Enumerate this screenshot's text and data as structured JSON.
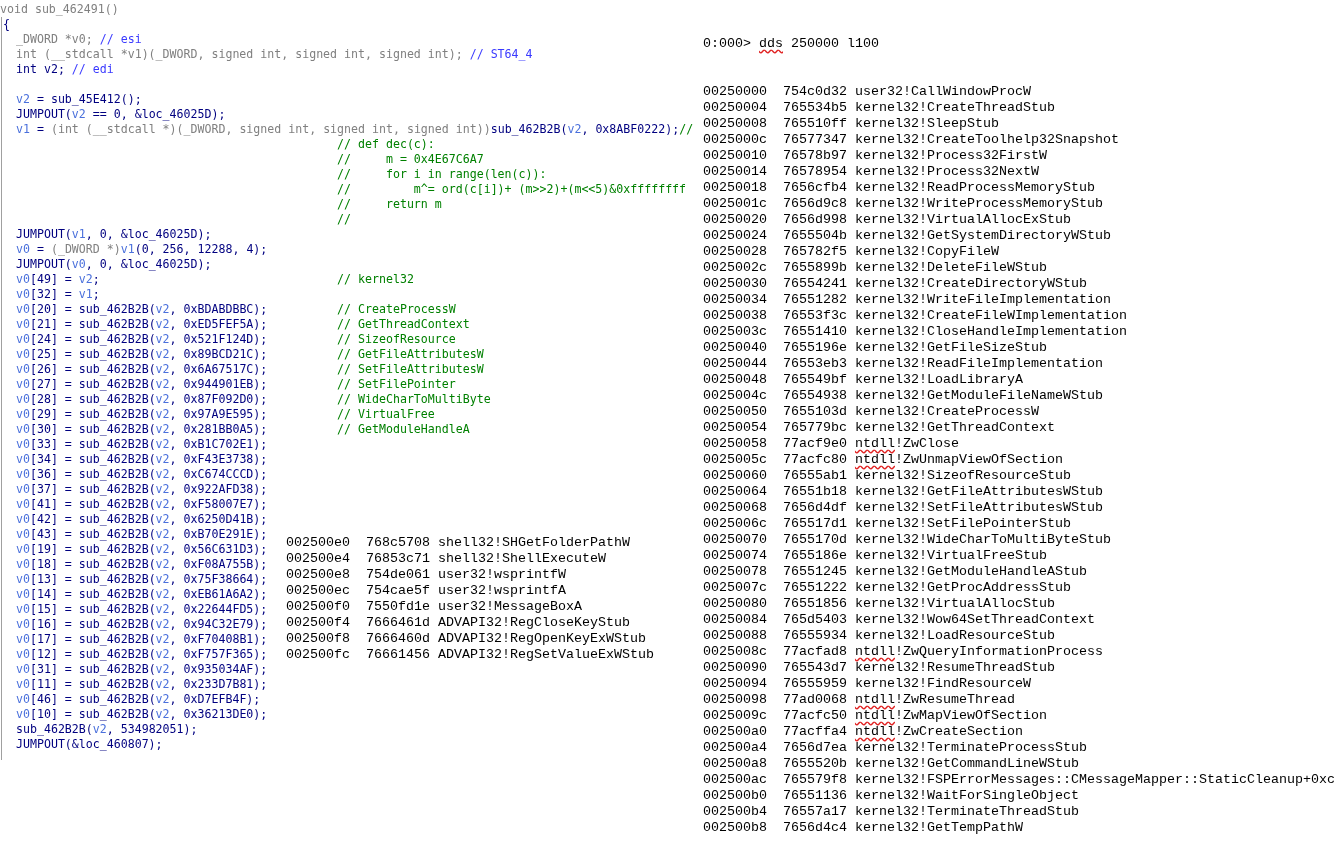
{
  "pseudocode": {
    "signature": [
      {
        "text": "void sub_462491()",
        "kind": "muted"
      }
    ],
    "brace": "{",
    "lines": [
      {
        "kind": "code",
        "segments": [
          {
            "text": "_DWORD *v0; ",
            "kind": "muted"
          },
          {
            "text": "// esi",
            "kind": "register"
          }
        ]
      },
      {
        "kind": "code",
        "segments": [
          {
            "text": "int (__stdcall *v1)(_DWORD, signed int, signed int, signed int); ",
            "kind": "muted"
          },
          {
            "text": "// ST64_4",
            "kind": "register"
          }
        ]
      },
      {
        "kind": "code",
        "segments": [
          {
            "text": "int v2; ",
            "kind": "plain"
          },
          {
            "text": "// edi",
            "kind": "register"
          }
        ]
      },
      {
        "kind": "blank"
      },
      {
        "kind": "code",
        "segments": [
          {
            "text": "v2",
            "kind": "variable"
          },
          {
            "text": " = sub_45E412();",
            "kind": "plain"
          }
        ]
      },
      {
        "kind": "code",
        "segments": [
          {
            "text": "JUMPOUT(",
            "kind": "plain"
          },
          {
            "text": "v2",
            "kind": "variable"
          },
          {
            "text": " == 0, &loc_46025D);",
            "kind": "plain"
          }
        ]
      },
      {
        "kind": "code",
        "segments": [
          {
            "text": "v1",
            "kind": "variable"
          },
          {
            "text": " = ",
            "kind": "plain"
          },
          {
            "text": "(int (__stdcall *)(_DWORD, signed int, signed int, signed int))",
            "kind": "muted"
          },
          {
            "text": "sub_462B2B(",
            "kind": "plain"
          },
          {
            "text": "v2",
            "kind": "variable"
          },
          {
            "text": ", 0x8ABF0222);",
            "kind": "plain"
          },
          {
            "text": "//",
            "kind": "comment"
          }
        ]
      },
      {
        "kind": "comment",
        "comment": "// def dec(c):"
      },
      {
        "kind": "comment",
        "comment": "//     m = 0x4E67C6A7"
      },
      {
        "kind": "comment",
        "comment": "//     for i in range(len(c)):"
      },
      {
        "kind": "comment",
        "comment": "//         m^= ord(c[i])+ (m>>2)+(m<<5)&0xffffffff"
      },
      {
        "kind": "comment",
        "comment": "//     return m"
      },
      {
        "kind": "comment",
        "comment": "//"
      },
      {
        "kind": "code",
        "segments": [
          {
            "text": "JUMPOUT(",
            "kind": "plain"
          },
          {
            "text": "v1",
            "kind": "variable"
          },
          {
            "text": ", 0, &loc_46025D);",
            "kind": "plain"
          }
        ]
      },
      {
        "kind": "code",
        "segments": [
          {
            "text": "v0",
            "kind": "variable"
          },
          {
            "text": " = ",
            "kind": "plain"
          },
          {
            "text": "(_DWORD *)",
            "kind": "muted"
          },
          {
            "text": "v1",
            "kind": "variable"
          },
          {
            "text": "(0, 256, 12288, 4);",
            "kind": "plain"
          }
        ]
      },
      {
        "kind": "code",
        "segments": [
          {
            "text": "JUMPOUT(",
            "kind": "plain"
          },
          {
            "text": "v0",
            "kind": "variable"
          },
          {
            "text": ", 0, &loc_46025D);",
            "kind": "plain"
          }
        ]
      },
      {
        "kind": "code",
        "segments": [
          {
            "text": "v0",
            "kind": "variable"
          },
          {
            "text": "[49] = ",
            "kind": "plain"
          },
          {
            "text": "v2",
            "kind": "variable"
          },
          {
            "text": ";",
            "kind": "plain"
          }
        ],
        "comment": "// kernel32"
      },
      {
        "kind": "code",
        "segments": [
          {
            "text": "v0",
            "kind": "variable"
          },
          {
            "text": "[32] = ",
            "kind": "plain"
          },
          {
            "text": "v1",
            "kind": "variable"
          },
          {
            "text": ";",
            "kind": "plain"
          }
        ]
      },
      {
        "kind": "code",
        "segments": [
          {
            "text": "v0",
            "kind": "variable"
          },
          {
            "text": "[20] = sub_462B2B(",
            "kind": "plain"
          },
          {
            "text": "v2",
            "kind": "variable"
          },
          {
            "text": ", 0xBDABDBBC);",
            "kind": "plain"
          }
        ],
        "comment": "// CreateProcessW"
      },
      {
        "kind": "code",
        "segments": [
          {
            "text": "v0",
            "kind": "variable"
          },
          {
            "text": "[21] = sub_462B2B(",
            "kind": "plain"
          },
          {
            "text": "v2",
            "kind": "variable"
          },
          {
            "text": ", 0xED5FEF5A);",
            "kind": "plain"
          }
        ],
        "comment": "// GetThreadContext"
      },
      {
        "kind": "code",
        "segments": [
          {
            "text": "v0",
            "kind": "variable"
          },
          {
            "text": "[24] = sub_462B2B(",
            "kind": "plain"
          },
          {
            "text": "v2",
            "kind": "variable"
          },
          {
            "text": ", 0x521F124D);",
            "kind": "plain"
          }
        ],
        "comment": "// SizeofResource"
      },
      {
        "kind": "code",
        "segments": [
          {
            "text": "v0",
            "kind": "variable"
          },
          {
            "text": "[25] = sub_462B2B(",
            "kind": "plain"
          },
          {
            "text": "v2",
            "kind": "variable"
          },
          {
            "text": ", 0x89BCD21C);",
            "kind": "plain"
          }
        ],
        "comment": "// GetFileAttributesW"
      },
      {
        "kind": "code",
        "segments": [
          {
            "text": "v0",
            "kind": "variable"
          },
          {
            "text": "[26] = sub_462B2B(",
            "kind": "plain"
          },
          {
            "text": "v2",
            "kind": "variable"
          },
          {
            "text": ", 0x6A67517C);",
            "kind": "plain"
          }
        ],
        "comment": "// SetFileAttributesW"
      },
      {
        "kind": "code",
        "segments": [
          {
            "text": "v0",
            "kind": "variable"
          },
          {
            "text": "[27] = sub_462B2B(",
            "kind": "plain"
          },
          {
            "text": "v2",
            "kind": "variable"
          },
          {
            "text": ", 0x944901EB);",
            "kind": "plain"
          }
        ],
        "comment": "// SetFilePointer"
      },
      {
        "kind": "code",
        "segments": [
          {
            "text": "v0",
            "kind": "variable"
          },
          {
            "text": "[28] = sub_462B2B(",
            "kind": "plain"
          },
          {
            "text": "v2",
            "kind": "variable"
          },
          {
            "text": ", 0x87F092D0);",
            "kind": "plain"
          }
        ],
        "comment": "// WideCharToMultiByte"
      },
      {
        "kind": "code",
        "segments": [
          {
            "text": "v0",
            "kind": "variable"
          },
          {
            "text": "[29] = sub_462B2B(",
            "kind": "plain"
          },
          {
            "text": "v2",
            "kind": "variable"
          },
          {
            "text": ", 0x97A9E595);",
            "kind": "plain"
          }
        ],
        "comment": "// VirtualFree"
      },
      {
        "kind": "code",
        "segments": [
          {
            "text": "v0",
            "kind": "variable"
          },
          {
            "text": "[30] = sub_462B2B(",
            "kind": "plain"
          },
          {
            "text": "v2",
            "kind": "variable"
          },
          {
            "text": ", 0x281BB0A5);",
            "kind": "plain"
          }
        ],
        "comment": "// GetModuleHandleA"
      },
      {
        "kind": "code",
        "segments": [
          {
            "text": "v0",
            "kind": "variable"
          },
          {
            "text": "[33] = sub_462B2B(",
            "kind": "plain"
          },
          {
            "text": "v2",
            "kind": "variable"
          },
          {
            "text": ", 0xB1C702E1);",
            "kind": "plain"
          }
        ]
      },
      {
        "kind": "code",
        "segments": [
          {
            "text": "v0",
            "kind": "variable"
          },
          {
            "text": "[34] = sub_462B2B(",
            "kind": "plain"
          },
          {
            "text": "v2",
            "kind": "variable"
          },
          {
            "text": ", 0xF43E3738);",
            "kind": "plain"
          }
        ]
      },
      {
        "kind": "code",
        "segments": [
          {
            "text": "v0",
            "kind": "variable"
          },
          {
            "text": "[36] = sub_462B2B(",
            "kind": "plain"
          },
          {
            "text": "v2",
            "kind": "variable"
          },
          {
            "text": ", 0xC674CCCD);",
            "kind": "plain"
          }
        ]
      },
      {
        "kind": "code",
        "segments": [
          {
            "text": "v0",
            "kind": "variable"
          },
          {
            "text": "[37] = sub_462B2B(",
            "kind": "plain"
          },
          {
            "text": "v2",
            "kind": "variable"
          },
          {
            "text": ", 0x922AFD38);",
            "kind": "plain"
          }
        ]
      },
      {
        "kind": "code",
        "segments": [
          {
            "text": "v0",
            "kind": "variable"
          },
          {
            "text": "[41] = sub_462B2B(",
            "kind": "plain"
          },
          {
            "text": "v2",
            "kind": "variable"
          },
          {
            "text": ", 0xF58007E7);",
            "kind": "plain"
          }
        ]
      },
      {
        "kind": "code",
        "segments": [
          {
            "text": "v0",
            "kind": "variable"
          },
          {
            "text": "[42] = sub_462B2B(",
            "kind": "plain"
          },
          {
            "text": "v2",
            "kind": "variable"
          },
          {
            "text": ", 0x6250D41B);",
            "kind": "plain"
          }
        ]
      },
      {
        "kind": "code",
        "segments": [
          {
            "text": "v0",
            "kind": "variable"
          },
          {
            "text": "[43] = sub_462B2B(",
            "kind": "plain"
          },
          {
            "text": "v2",
            "kind": "variable"
          },
          {
            "text": ", 0xB70E291E);",
            "kind": "plain"
          }
        ]
      },
      {
        "kind": "code",
        "segments": [
          {
            "text": "v0",
            "kind": "variable"
          },
          {
            "text": "[19] = sub_462B2B(",
            "kind": "plain"
          },
          {
            "text": "v2",
            "kind": "variable"
          },
          {
            "text": ", 0x56C631D3);",
            "kind": "plain"
          }
        ]
      },
      {
        "kind": "code",
        "segments": [
          {
            "text": "v0",
            "kind": "variable"
          },
          {
            "text": "[18] = sub_462B2B(",
            "kind": "plain"
          },
          {
            "text": "v2",
            "kind": "variable"
          },
          {
            "text": ", 0xF08A755B);",
            "kind": "plain"
          }
        ]
      },
      {
        "kind": "code",
        "segments": [
          {
            "text": "v0",
            "kind": "variable"
          },
          {
            "text": "[13] = sub_462B2B(",
            "kind": "plain"
          },
          {
            "text": "v2",
            "kind": "variable"
          },
          {
            "text": ", 0x75F38664);",
            "kind": "plain"
          }
        ]
      },
      {
        "kind": "code",
        "segments": [
          {
            "text": "v0",
            "kind": "variable"
          },
          {
            "text": "[14] = sub_462B2B(",
            "kind": "plain"
          },
          {
            "text": "v2",
            "kind": "variable"
          },
          {
            "text": ", 0xEB61A6A2);",
            "kind": "plain"
          }
        ]
      },
      {
        "kind": "code",
        "segments": [
          {
            "text": "v0",
            "kind": "variable"
          },
          {
            "text": "[15] = sub_462B2B(",
            "kind": "plain"
          },
          {
            "text": "v2",
            "kind": "variable"
          },
          {
            "text": ", 0x22644FD5);",
            "kind": "plain"
          }
        ]
      },
      {
        "kind": "code",
        "segments": [
          {
            "text": "v0",
            "kind": "variable"
          },
          {
            "text": "[16] = sub_462B2B(",
            "kind": "plain"
          },
          {
            "text": "v2",
            "kind": "variable"
          },
          {
            "text": ", 0x94C32E79);",
            "kind": "plain"
          }
        ]
      },
      {
        "kind": "code",
        "segments": [
          {
            "text": "v0",
            "kind": "variable"
          },
          {
            "text": "[17] = sub_462B2B(",
            "kind": "plain"
          },
          {
            "text": "v2",
            "kind": "variable"
          },
          {
            "text": ", 0xF70408B1);",
            "kind": "plain"
          }
        ]
      },
      {
        "kind": "code",
        "segments": [
          {
            "text": "v0",
            "kind": "variable"
          },
          {
            "text": "[12] = sub_462B2B(",
            "kind": "plain"
          },
          {
            "text": "v2",
            "kind": "variable"
          },
          {
            "text": ", 0xF757F365);",
            "kind": "plain"
          }
        ]
      },
      {
        "kind": "code",
        "segments": [
          {
            "text": "v0",
            "kind": "variable"
          },
          {
            "text": "[31] = sub_462B2B(",
            "kind": "plain"
          },
          {
            "text": "v2",
            "kind": "variable"
          },
          {
            "text": ", 0x935034AF);",
            "kind": "plain"
          }
        ]
      },
      {
        "kind": "code",
        "segments": [
          {
            "text": "v0",
            "kind": "variable"
          },
          {
            "text": "[11] = sub_462B2B(",
            "kind": "plain"
          },
          {
            "text": "v2",
            "kind": "variable"
          },
          {
            "text": ", 0x233D7B81);",
            "kind": "plain"
          }
        ]
      },
      {
        "kind": "code",
        "segments": [
          {
            "text": "v0",
            "kind": "variable"
          },
          {
            "text": "[46] = sub_462B2B(",
            "kind": "plain"
          },
          {
            "text": "v2",
            "kind": "variable"
          },
          {
            "text": ", 0xD7EFB4F);",
            "kind": "plain"
          }
        ]
      },
      {
        "kind": "code",
        "segments": [
          {
            "text": "v0",
            "kind": "variable"
          },
          {
            "text": "[10] = sub_462B2B(",
            "kind": "plain"
          },
          {
            "text": "v2",
            "kind": "variable"
          },
          {
            "text": ", 0x36213DE0);",
            "kind": "plain"
          }
        ]
      },
      {
        "kind": "code",
        "segments": [
          {
            "text": "sub_462B2B(",
            "kind": "plain"
          },
          {
            "text": "v2",
            "kind": "variable"
          },
          {
            "text": ", 534982051);",
            "kind": "plain"
          }
        ]
      },
      {
        "kind": "code",
        "segments": [
          {
            "text": "JUMPOUT(&loc_460807);",
            "kind": "plain"
          }
        ]
      }
    ]
  },
  "pasted_output": {
    "rows": [
      {
        "address": "002500e0",
        "value": "768c5708",
        "module": "shell32",
        "function": "!SHGetFolderPathW",
        "flagged": false
      },
      {
        "address": "002500e4",
        "value": "76853c71",
        "module": "shell32",
        "function": "!ShellExecuteW",
        "flagged": false
      },
      {
        "address": "002500e8",
        "value": "754de061",
        "module": "user32",
        "function": "!wsprintfW",
        "flagged": false
      },
      {
        "address": "002500ec",
        "value": "754cae5f",
        "module": "user32",
        "function": "!wsprintfA",
        "flagged": false
      },
      {
        "address": "002500f0",
        "value": "7550fd1e",
        "module": "user32",
        "function": "!MessageBoxA",
        "flagged": false
      },
      {
        "address": "002500f4",
        "value": "7666461d",
        "module": "ADVAPI32",
        "function": "!RegCloseKeyStub",
        "flagged": false
      },
      {
        "address": "002500f8",
        "value": "7666460d",
        "module": "ADVAPI32",
        "function": "!RegOpenKeyExWStub",
        "flagged": false
      },
      {
        "address": "002500fc",
        "value": "76661456",
        "module": "ADVAPI32",
        "function": "!RegSetValueExWStub",
        "flagged": false
      }
    ]
  },
  "debugger_output": {
    "prompt": "0:000>",
    "command": "dds",
    "arguments": "250000 l100",
    "flagged": true,
    "rows": [
      {
        "address": "00250000",
        "value": "754c0d32",
        "module": "user32",
        "function": "!CallWindowProcW",
        "flagged": false
      },
      {
        "address": "00250004",
        "value": "765534b5",
        "module": "kernel32",
        "function": "!CreateThreadStub",
        "flagged": false
      },
      {
        "address": "00250008",
        "value": "765510ff",
        "module": "kernel32",
        "function": "!SleepStub",
        "flagged": false
      },
      {
        "address": "0025000c",
        "value": "76577347",
        "module": "kernel32",
        "function": "!CreateToolhelp32Snapshot",
        "flagged": false
      },
      {
        "address": "00250010",
        "value": "76578b97",
        "module": "kernel32",
        "function": "!Process32FirstW",
        "flagged": false
      },
      {
        "address": "00250014",
        "value": "76578954",
        "module": "kernel32",
        "function": "!Process32NextW",
        "flagged": false
      },
      {
        "address": "00250018",
        "value": "7656cfb4",
        "module": "kernel32",
        "function": "!ReadProcessMemoryStub",
        "flagged": false
      },
      {
        "address": "0025001c",
        "value": "7656d9c8",
        "module": "kernel32",
        "function": "!WriteProcessMemoryStub",
        "flagged": false
      },
      {
        "address": "00250020",
        "value": "7656d998",
        "module": "kernel32",
        "function": "!VirtualAllocExStub",
        "flagged": false
      },
      {
        "address": "00250024",
        "value": "7655504b",
        "module": "kernel32",
        "function": "!GetSystemDirectoryWStub",
        "flagged": false
      },
      {
        "address": "00250028",
        "value": "765782f5",
        "module": "kernel32",
        "function": "!CopyFileW",
        "flagged": false
      },
      {
        "address": "0025002c",
        "value": "7655899b",
        "module": "kernel32",
        "function": "!DeleteFileWStub",
        "flagged": false
      },
      {
        "address": "00250030",
        "value": "76554241",
        "module": "kernel32",
        "function": "!CreateDirectoryWStub",
        "flagged": false
      },
      {
        "address": "00250034",
        "value": "76551282",
        "module": "kernel32",
        "function": "!WriteFileImplementation",
        "flagged": false
      },
      {
        "address": "00250038",
        "value": "76553f3c",
        "module": "kernel32",
        "function": "!CreateFileWImplementation",
        "flagged": false
      },
      {
        "address": "0025003c",
        "value": "76551410",
        "module": "kernel32",
        "function": "!CloseHandleImplementation",
        "flagged": false
      },
      {
        "address": "00250040",
        "value": "7655196e",
        "module": "kernel32",
        "function": "!GetFileSizeStub",
        "flagged": false
      },
      {
        "address": "00250044",
        "value": "76553eb3",
        "module": "kernel32",
        "function": "!ReadFileImplementation",
        "flagged": false
      },
      {
        "address": "00250048",
        "value": "765549bf",
        "module": "kernel32",
        "function": "!LoadLibraryA",
        "flagged": false
      },
      {
        "address": "0025004c",
        "value": "76554938",
        "module": "kernel32",
        "function": "!GetModuleFileNameWStub",
        "flagged": false
      },
      {
        "address": "00250050",
        "value": "7655103d",
        "module": "kernel32",
        "function": "!CreateProcessW",
        "flagged": false
      },
      {
        "address": "00250054",
        "value": "765779bc",
        "module": "kernel32",
        "function": "!GetThreadContext",
        "flagged": false
      },
      {
        "address": "00250058",
        "value": "77acf9e0",
        "module": "ntdll",
        "function": "!ZwClose",
        "flagged": true
      },
      {
        "address": "0025005c",
        "value": "77acfc80",
        "module": "ntdll",
        "function": "!ZwUnmapViewOfSection",
        "flagged": true
      },
      {
        "address": "00250060",
        "value": "76555ab1",
        "module": "kernel32",
        "function": "!SizeofResourceStub",
        "flagged": false
      },
      {
        "address": "00250064",
        "value": "76551b18",
        "module": "kernel32",
        "function": "!GetFileAttributesWStub",
        "flagged": false
      },
      {
        "address": "00250068",
        "value": "7656d4df",
        "module": "kernel32",
        "function": "!SetFileAttributesWStub",
        "flagged": false
      },
      {
        "address": "0025006c",
        "value": "765517d1",
        "module": "kernel32",
        "function": "!SetFilePointerStub",
        "flagged": false
      },
      {
        "address": "00250070",
        "value": "7655170d",
        "module": "kernel32",
        "function": "!WideCharToMultiByteStub",
        "flagged": false
      },
      {
        "address": "00250074",
        "value": "7655186e",
        "module": "kernel32",
        "function": "!VirtualFreeStub",
        "flagged": false
      },
      {
        "address": "00250078",
        "value": "76551245",
        "module": "kernel32",
        "function": "!GetModuleHandleAStub",
        "flagged": false
      },
      {
        "address": "0025007c",
        "value": "76551222",
        "module": "kernel32",
        "function": "!GetProcAddressStub",
        "flagged": false
      },
      {
        "address": "00250080",
        "value": "76551856",
        "module": "kernel32",
        "function": "!VirtualAllocStub",
        "flagged": false
      },
      {
        "address": "00250084",
        "value": "765d5403",
        "module": "kernel32",
        "function": "!Wow64SetThreadContext",
        "flagged": false
      },
      {
        "address": "00250088",
        "value": "76555934",
        "module": "kernel32",
        "function": "!LoadResourceStub",
        "flagged": false
      },
      {
        "address": "0025008c",
        "value": "77acfad8",
        "module": "ntdll",
        "function": "!ZwQueryInformationProcess",
        "flagged": true
      },
      {
        "address": "00250090",
        "value": "765543d7",
        "module": "kernel32",
        "function": "!ResumeThreadStub",
        "flagged": false
      },
      {
        "address": "00250094",
        "value": "76555959",
        "module": "kernel32",
        "function": "!FindResourceW",
        "flagged": false
      },
      {
        "address": "00250098",
        "value": "77ad0068",
        "module": "ntdll",
        "function": "!ZwResumeThread",
        "flagged": true
      },
      {
        "address": "0025009c",
        "value": "77acfc50",
        "module": "ntdll",
        "function": "!ZwMapViewOfSection",
        "flagged": true
      },
      {
        "address": "002500a0",
        "value": "77acffa4",
        "module": "ntdll",
        "function": "!ZwCreateSection",
        "flagged": true
      },
      {
        "address": "002500a4",
        "value": "7656d7ea",
        "module": "kernel32",
        "function": "!TerminateProcessStub",
        "flagged": false
      },
      {
        "address": "002500a8",
        "value": "7655520b",
        "module": "kernel32",
        "function": "!GetCommandLineWStub",
        "flagged": false
      },
      {
        "address": "002500ac",
        "value": "765579f8",
        "module": "kernel32",
        "function": "!FSPErrorMessages::CMessageMapper::StaticCleanup+0xc",
        "flagged": false
      },
      {
        "address": "002500b0",
        "value": "76551136",
        "module": "kernel32",
        "function": "!WaitForSingleObject",
        "flagged": false
      },
      {
        "address": "002500b4",
        "value": "76557a17",
        "module": "kernel32",
        "function": "!TerminateThreadStub",
        "flagged": false
      },
      {
        "address": "002500b8",
        "value": "7656d4c4",
        "module": "kernel32",
        "function": "!GetTempPathW",
        "flagged": false
      }
    ]
  }
}
